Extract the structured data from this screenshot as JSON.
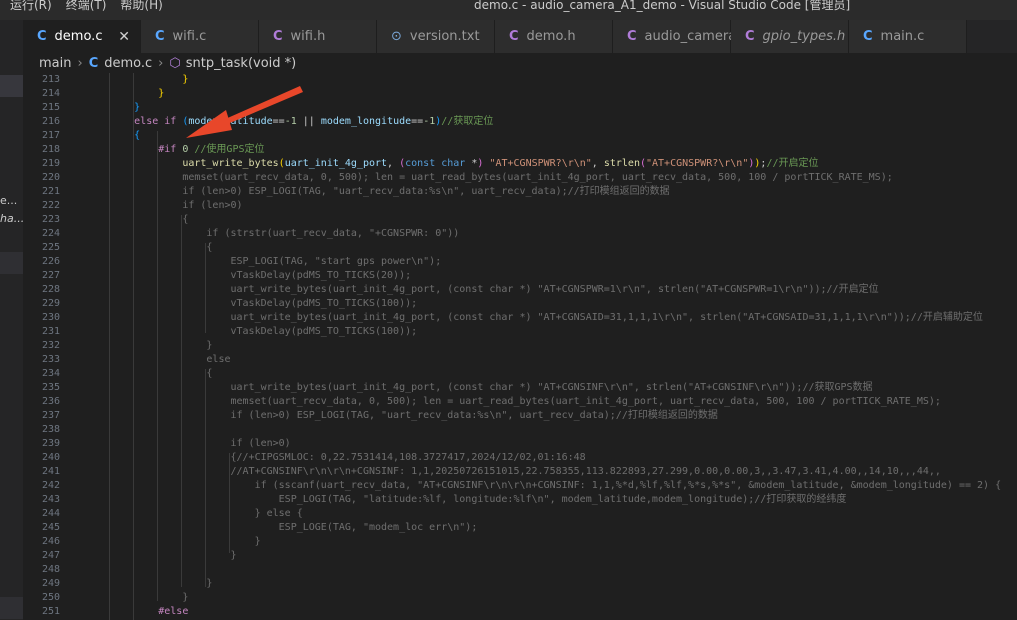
{
  "titlebar": {
    "menu": [
      "运行(R)",
      "终端(T)",
      "帮助(H)"
    ],
    "title": "demo.c - audio_camera_A1_demo - Visual Studio Code [管理员]"
  },
  "tabs": [
    {
      "label": "demo.c",
      "type": "c",
      "active": true
    },
    {
      "label": "wifi.c",
      "type": "c"
    },
    {
      "label": "wifi.h",
      "type": "h"
    },
    {
      "label": "version.txt",
      "type": "t"
    },
    {
      "label": "demo.h",
      "type": "h"
    },
    {
      "label": "audio_camera.h",
      "type": "h"
    },
    {
      "label": "gpio_types.h",
      "type": "h",
      "italic": true
    },
    {
      "label": "main.c",
      "type": "c"
    }
  ],
  "icons": {
    "close": "close-icon",
    "c_file": "c-file-icon",
    "h_file": "h-file-icon",
    "txt_file": "txt-file-icon",
    "symbol": "cube-method-icon",
    "arrow": "red-arrow-annotation"
  },
  "leftpanel": {
    "snippets": [
      "e...",
      "ha..."
    ]
  },
  "breadcrumb": {
    "root": "main",
    "file": "demo.c",
    "symbol": "sntp_task(void *)"
  },
  "colors": {
    "accent_arrow": "#e8472a",
    "c_icon": "#59a7ff",
    "h_icon": "#b07cd8",
    "comment": "#6a9955",
    "string": "#ce9178",
    "keyword": "#569cd6"
  },
  "lines": [
    {
      "n": "213",
      "ind": 0,
      "segs": [
        [
          "brace3",
          "                }"
        ]
      ]
    },
    {
      "n": "214",
      "ind": 0,
      "segs": [
        [
          "brace3",
          "            }"
        ]
      ]
    },
    {
      "n": "215",
      "ind": 0,
      "segs": [
        [
          "brace2",
          "        }"
        ]
      ]
    },
    {
      "n": "216",
      "ind": 0,
      "segs": [
        [
          "ctl",
          "        else if "
        ],
        [
          "brace2",
          "("
        ],
        [
          "var",
          "modem_latitude"
        ],
        [
          "",
          "=="
        ],
        [
          "num",
          "-1"
        ],
        [
          "",
          " || "
        ],
        [
          "var",
          "modem_longitude"
        ],
        [
          "",
          "=="
        ],
        [
          "num",
          "-1"
        ],
        [
          "brace2",
          ")"
        ],
        [
          "cm",
          "//获取定位"
        ]
      ]
    },
    {
      "n": "217",
      "ind": 0,
      "segs": [
        [
          "brace2",
          "        {"
        ]
      ]
    },
    {
      "n": "218",
      "ind": 0,
      "segs": [
        [
          "pre",
          "            #if "
        ],
        [
          "num",
          "0"
        ],
        [
          "cm",
          " //使用GPS定位"
        ]
      ]
    },
    {
      "n": "219",
      "ind": 0,
      "segs": [
        [
          "fn",
          "                uart_write_bytes"
        ],
        [
          "brace3",
          "("
        ],
        [
          "var",
          "uart_init_4g_port"
        ],
        [
          "",
          ", "
        ],
        [
          "brace1",
          "("
        ],
        [
          "kw",
          "const char"
        ],
        [
          "",
          " *"
        ],
        [
          "brace1",
          ")"
        ],
        [
          "str",
          " \"AT+CGNSPWR?\\r\\n\""
        ],
        [
          "",
          ", "
        ],
        [
          "fn",
          "strlen"
        ],
        [
          "brace1",
          "("
        ],
        [
          "str",
          "\"AT+CGNSPWR?\\r\\n\""
        ],
        [
          "brace1",
          ")"
        ],
        [
          "brace3",
          ")"
        ],
        [
          "",
          ";"
        ],
        [
          "cm",
          "//开启定位"
        ]
      ]
    },
    {
      "n": "220",
      "ind": 1,
      "segs": [
        [
          "",
          "                memset(uart_recv_data, 0, 500); len = uart_read_bytes(uart_init_4g_port, uart_recv_data, 500, 100 / portTICK_RATE_MS);"
        ]
      ]
    },
    {
      "n": "221",
      "ind": 1,
      "segs": [
        [
          "",
          "                if (len>0) ESP_LOGI(TAG, \"uart_recv_data:%s\\n\", uart_recv_data);//打印模组返回的数据"
        ]
      ]
    },
    {
      "n": "222",
      "ind": 1,
      "segs": [
        [
          "",
          "                if (len>0)"
        ]
      ]
    },
    {
      "n": "223",
      "ind": 1,
      "segs": [
        [
          "",
          "                {"
        ]
      ]
    },
    {
      "n": "224",
      "ind": 1,
      "segs": [
        [
          "",
          "                    if (strstr(uart_recv_data, \"+CGNSPWR: 0\"))"
        ]
      ]
    },
    {
      "n": "225",
      "ind": 1,
      "segs": [
        [
          "",
          "                    {"
        ]
      ]
    },
    {
      "n": "226",
      "ind": 1,
      "segs": [
        [
          "",
          "                        ESP_LOGI(TAG, \"start gps power\\n\");"
        ]
      ]
    },
    {
      "n": "227",
      "ind": 1,
      "segs": [
        [
          "",
          "                        vTaskDelay(pdMS_TO_TICKS(20));"
        ]
      ]
    },
    {
      "n": "228",
      "ind": 1,
      "segs": [
        [
          "",
          "                        uart_write_bytes(uart_init_4g_port, (const char *) \"AT+CGNSPWR=1\\r\\n\", strlen(\"AT+CGNSPWR=1\\r\\n\"));//开启定位"
        ]
      ]
    },
    {
      "n": "229",
      "ind": 1,
      "segs": [
        [
          "",
          "                        vTaskDelay(pdMS_TO_TICKS(100));"
        ]
      ]
    },
    {
      "n": "230",
      "ind": 1,
      "segs": [
        [
          "",
          "                        uart_write_bytes(uart_init_4g_port, (const char *) \"AT+CGNSAID=31,1,1,1\\r\\n\", strlen(\"AT+CGNSAID=31,1,1,1\\r\\n\"));//开启辅助定位"
        ]
      ]
    },
    {
      "n": "231",
      "ind": 1,
      "segs": [
        [
          "",
          "                        vTaskDelay(pdMS_TO_TICKS(100));"
        ]
      ]
    },
    {
      "n": "232",
      "ind": 1,
      "segs": [
        [
          "",
          "                    }"
        ]
      ]
    },
    {
      "n": "233",
      "ind": 1,
      "segs": [
        [
          "",
          "                    else"
        ]
      ]
    },
    {
      "n": "234",
      "ind": 1,
      "segs": [
        [
          "",
          "                    {"
        ]
      ]
    },
    {
      "n": "235",
      "ind": 1,
      "segs": [
        [
          "",
          "                        uart_write_bytes(uart_init_4g_port, (const char *) \"AT+CGNSINF\\r\\n\", strlen(\"AT+CGNSINF\\r\\n\"));//获取GPS数据"
        ]
      ]
    },
    {
      "n": "236",
      "ind": 1,
      "segs": [
        [
          "",
          "                        memset(uart_recv_data, 0, 500); len = uart_read_bytes(uart_init_4g_port, uart_recv_data, 500, 100 / portTICK_RATE_MS);"
        ]
      ]
    },
    {
      "n": "237",
      "ind": 1,
      "segs": [
        [
          "",
          "                        if (len>0) ESP_LOGI(TAG, \"uart_recv_data:%s\\n\", uart_recv_data);//打印模组返回的数据"
        ]
      ]
    },
    {
      "n": "238",
      "ind": 1,
      "segs": [
        [
          "",
          ""
        ]
      ]
    },
    {
      "n": "239",
      "ind": 1,
      "segs": [
        [
          "",
          "                        if (len>0)"
        ]
      ]
    },
    {
      "n": "240",
      "ind": 1,
      "segs": [
        [
          "",
          "                        {//+CIPGSMLOC: 0,22.7531414,108.3727417,2024/12/02,01:16:48"
        ]
      ]
    },
    {
      "n": "241",
      "ind": 1,
      "segs": [
        [
          "",
          "                        //AT+CGNSINF\\r\\n\\r\\n+CGNSINF: 1,1,20250726151015,22.758355,113.822893,27.299,0.00,0.00,3,,3.47,3.41,4.00,,14,10,,,44,,"
        ]
      ]
    },
    {
      "n": "242",
      "ind": 1,
      "segs": [
        [
          "",
          "                            if (sscanf(uart_recv_data, \"AT+CGNSINF\\r\\n\\r\\n+CGNSINF: 1,1,%*d,%lf,%lf,%*s,%*s\", &modem_latitude, &modem_longitude) == 2) {"
        ]
      ]
    },
    {
      "n": "243",
      "ind": 1,
      "segs": [
        [
          "",
          "                                ESP_LOGI(TAG, \"latitude:%lf, longitude:%lf\\n\", modem_latitude,modem_longitude);//打印获取的经纬度"
        ]
      ]
    },
    {
      "n": "244",
      "ind": 1,
      "segs": [
        [
          "",
          "                            } else {"
        ]
      ]
    },
    {
      "n": "245",
      "ind": 1,
      "segs": [
        [
          "",
          "                                ESP_LOGE(TAG, \"modem_loc err\\n\");"
        ]
      ]
    },
    {
      "n": "246",
      "ind": 1,
      "segs": [
        [
          "",
          "                            }"
        ]
      ]
    },
    {
      "n": "247",
      "ind": 1,
      "segs": [
        [
          "",
          "                        }"
        ]
      ]
    },
    {
      "n": "248",
      "ind": 1,
      "segs": [
        [
          "",
          ""
        ]
      ]
    },
    {
      "n": "249",
      "ind": 1,
      "segs": [
        [
          "",
          "                    }"
        ]
      ]
    },
    {
      "n": "250",
      "ind": 1,
      "segs": [
        [
          "",
          "                }"
        ]
      ]
    },
    {
      "n": "251",
      "ind": 0,
      "segs": [
        [
          "pre",
          "            #else"
        ]
      ]
    }
  ]
}
